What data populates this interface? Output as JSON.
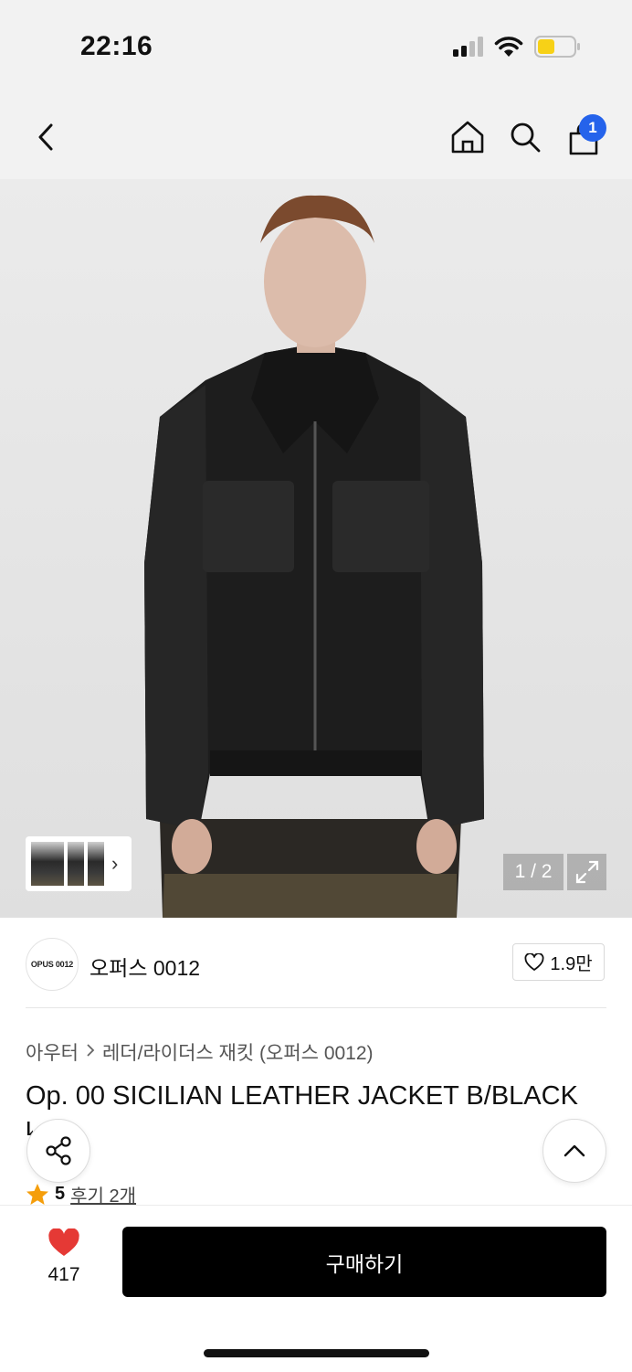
{
  "status_bar": {
    "time": "22:16",
    "battery_color": "#f7d117"
  },
  "nav": {
    "icons": [
      "back-icon",
      "home-icon",
      "search-icon",
      "cart-icon"
    ],
    "cart_badge": "1"
  },
  "gallery": {
    "counter": "1 / 2",
    "thumb_arrow": "›"
  },
  "brand": {
    "logo_text": "OPUS 0012",
    "name": "오퍼스 0012",
    "likes": "1.9만"
  },
  "breadcrumb": {
    "category": "아우터",
    "subcategory": "레더/라이더스 재킷 (오퍼스 0012)"
  },
  "product": {
    "title": "Op. 00 SICILIAN LEATHER JACKET B/BLACK",
    "rating": "5",
    "reviews": "후기 2개"
  },
  "bottom": {
    "wish_count": "417",
    "buy_label": "구매하기",
    "accent": "#e53935"
  }
}
